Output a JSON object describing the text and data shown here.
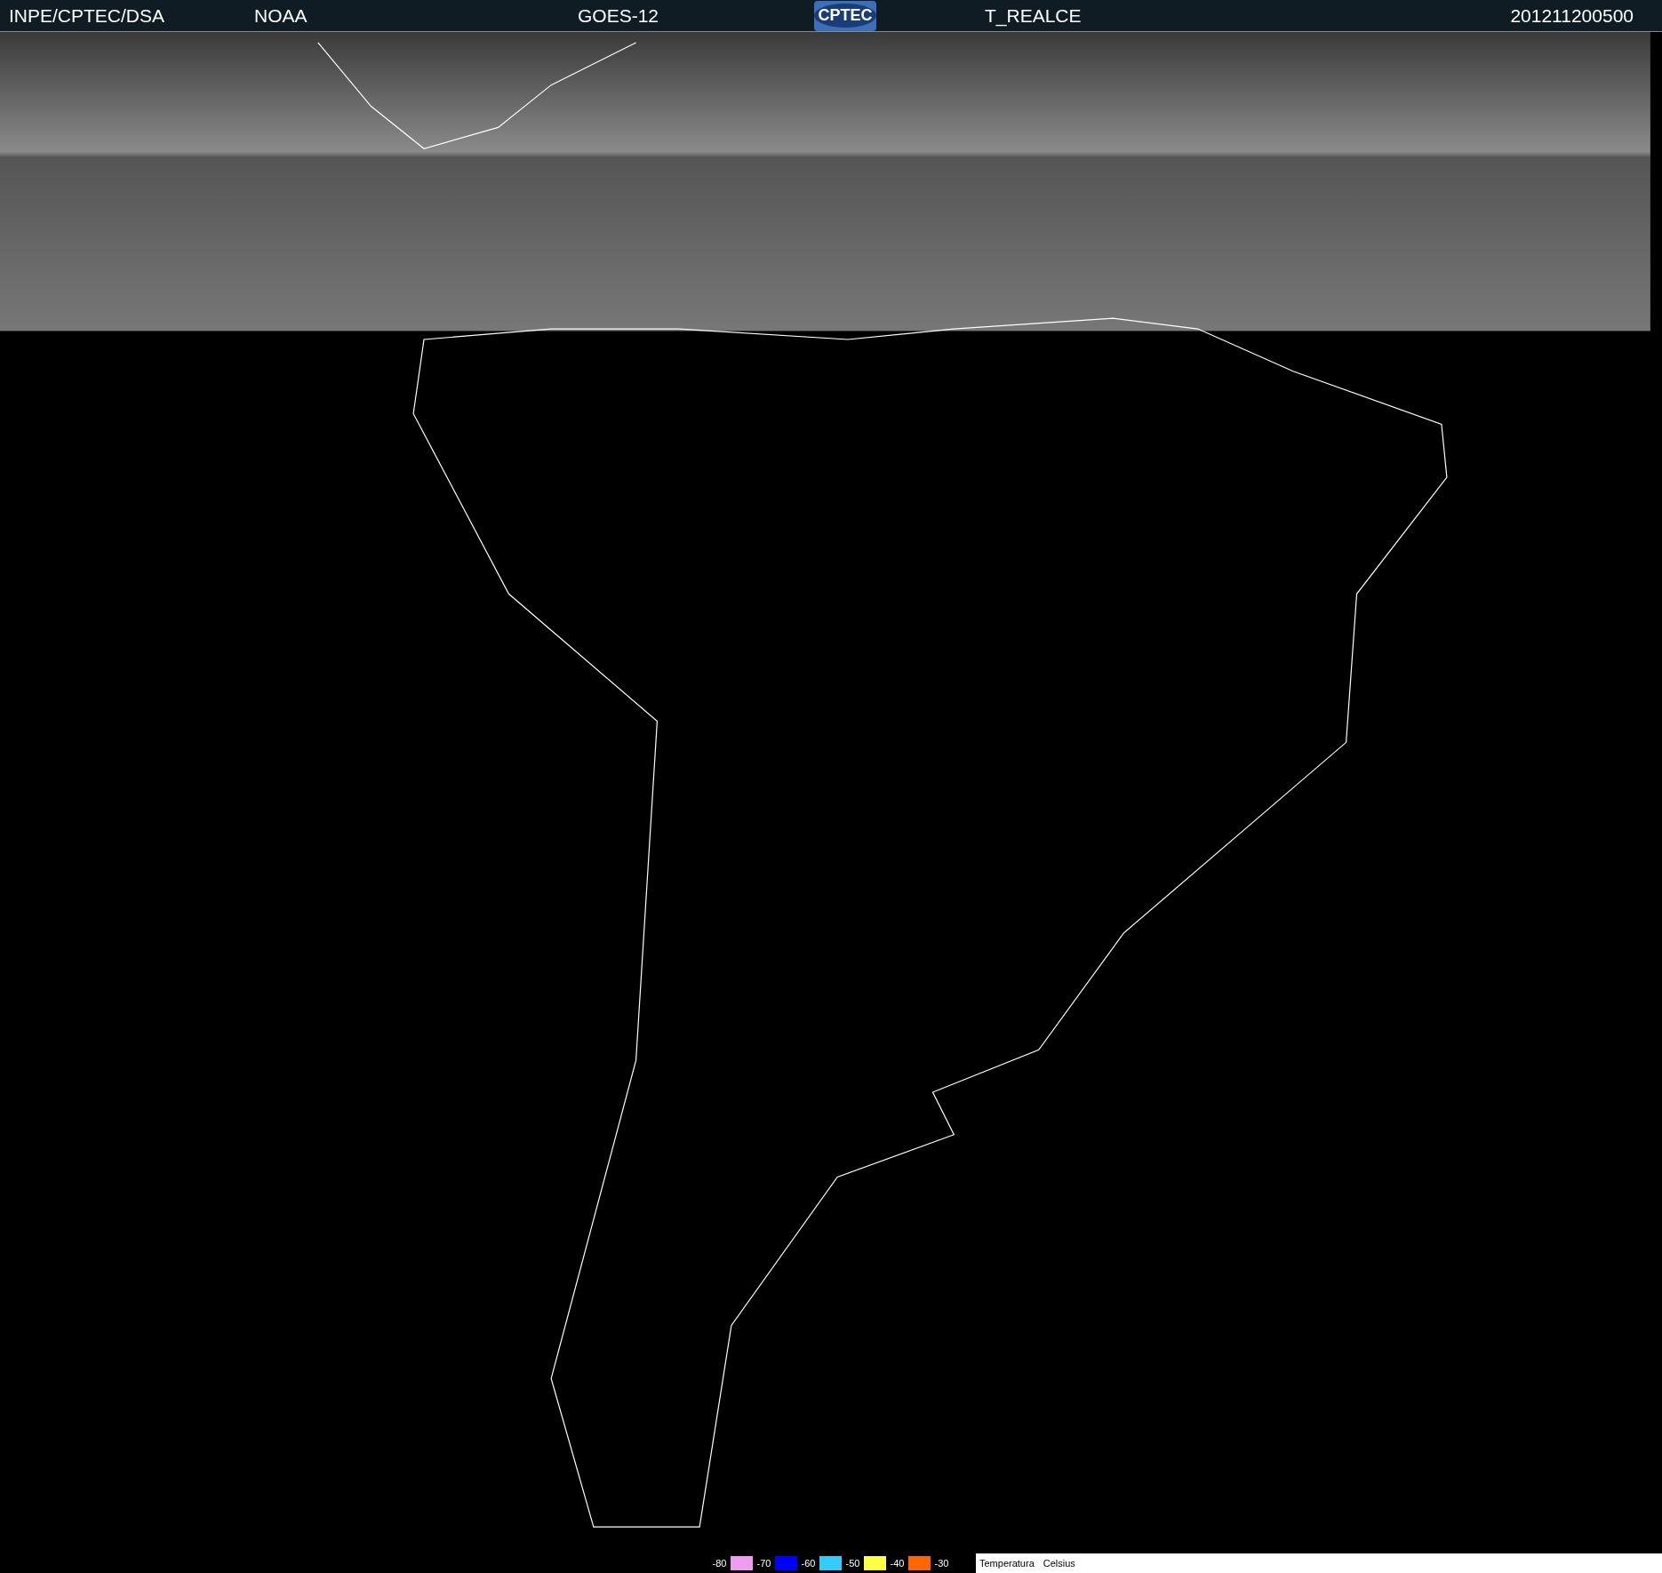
{
  "header": {
    "left_texts": [
      "INPE/CPTEC/DSA",
      "NOAA",
      "GOES-12"
    ],
    "logo_text": "CPTEC",
    "product": "T_REALCE",
    "timestamp": "201211200500"
  },
  "legend": {
    "steps": [
      {
        "label": "-80",
        "color": "#f09cf0"
      },
      {
        "label": "-70",
        "color": "#0000ff"
      },
      {
        "label": "-60",
        "color": "#33ccff"
      },
      {
        "label": "-50",
        "color": "#ffff44"
      },
      {
        "label": "-40",
        "color": "#ff6600"
      },
      {
        "label": "-30"
      }
    ],
    "caption": [
      "Temperatura",
      "Celsius"
    ]
  }
}
